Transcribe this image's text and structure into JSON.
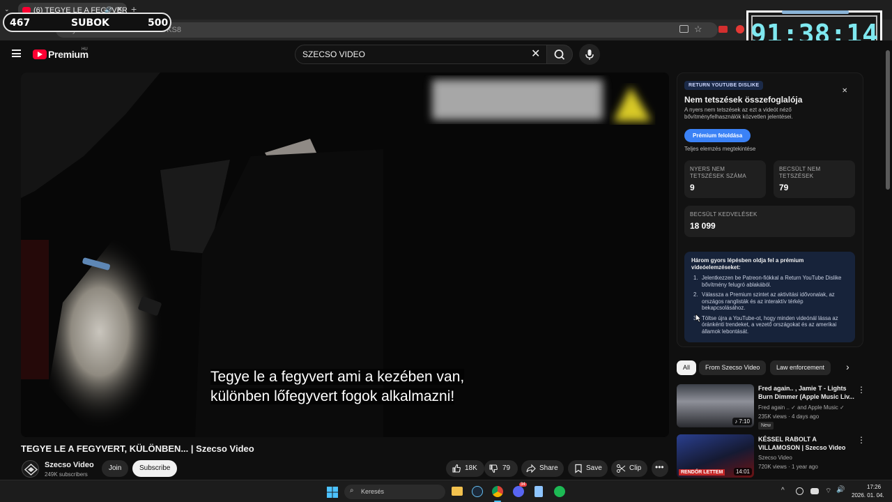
{
  "browser": {
    "tab_title": "(6) TEGYE LE A FEGYVERT, K",
    "url_fragment": "youtube.com/watch?v=...ATKS8"
  },
  "overlay": {
    "count_left": "467",
    "label": "SUBOK",
    "count_right": "500",
    "timer": "91:38:14"
  },
  "yt_header": {
    "logo_text": "Premium",
    "logo_region": "HU",
    "search_value": "SZECSO VIDEO"
  },
  "video": {
    "subtitle_line1": "Tegye le a fegyvert ami a kezében van,",
    "subtitle_line2": "különben lőfegyvert fogok alkalmazni!",
    "title": "TEGYE LE A FEGYVERT, KÜLÖNBEN... | Szecso Video"
  },
  "channel": {
    "name": "Szecso Video",
    "subscribers": "249K subscribers",
    "join_label": "Join",
    "subscribe_label": "Subscribe"
  },
  "actions": {
    "likes": "18K",
    "dislikes": "79",
    "share": "Share",
    "save": "Save",
    "clip": "Clip"
  },
  "ryd": {
    "badge": "RETURN YOUTUBE DISLIKE",
    "title": "Nem tetszések összefoglalója",
    "desc": "A nyers nem tetszések az ezt a videót néző bővítményfelhasználók közvetlen jelentései.",
    "premium_button": "Prémium feloldása",
    "full_analysis": "Teljes elemzés megtekintése",
    "raw_dislikes_label": "NYERS NEM TETSZÉSEK SZÁMA",
    "raw_dislikes_value": "9",
    "est_dislikes_label": "BECSÜLT NEM TETSZÉSEK",
    "est_dislikes_value": "79",
    "est_likes_label": "BECSÜLT KEDVELÉSEK",
    "est_likes_value": "18 099",
    "steps_title": "Három gyors lépésben oldja fel a prémium videóelemzéseket:",
    "step1": "Jelentkezzen be Patreon-fiókkal a Return YouTube Dislike bővítmény felugró ablakából.",
    "step2": "Válassza a Premium szintet az aktivitási idővonalak, az országos ranglisták és az interaktív térkép bekapcsolásához.",
    "step3": "Töltse újra a YouTube-ot, hogy minden videónál lássa az óránkénti trendeket, a vezető országokat és az amerikai államok lebontását."
  },
  "chips": [
    "All",
    "From Szecso Video",
    "Law enforcement"
  ],
  "recommendations": [
    {
      "title": "Fred again.. , Jamie T - Lights Burn Dimmer (Apple Music Liv...",
      "channel": "Fred again .. ✓ and Apple Music ✓",
      "meta": "235K views · 4 days ago",
      "badge": "New",
      "duration": "7:10"
    },
    {
      "title": "KÉSSEL RABOLT A VILLAMOSON | Szecso Video",
      "channel": "Szecso Video",
      "meta": "720K views · 1 year ago",
      "badge": "",
      "duration": "14:01",
      "thumb_text": "RENDŐR LETTEM"
    }
  ],
  "taskbar": {
    "search_placeholder": "Keresés",
    "time": "17:26",
    "date": "2026. 01. 04.",
    "discord_badge": "34"
  }
}
